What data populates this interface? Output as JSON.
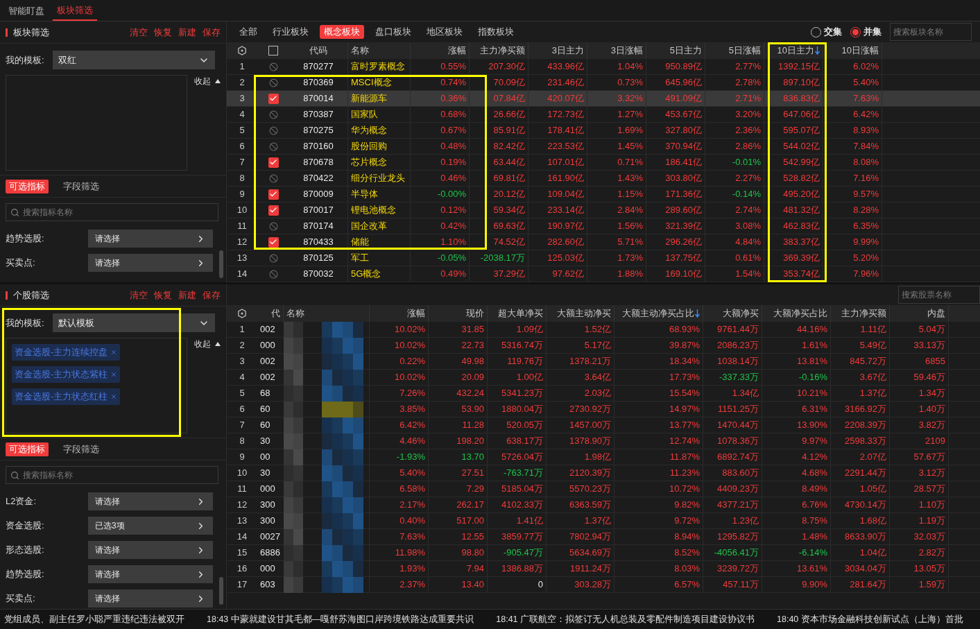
{
  "nav_tabs": [
    {
      "label": "智能盯盘",
      "selected": false
    },
    {
      "label": "板块筛选",
      "selected": true
    }
  ],
  "left_top": {
    "title": "板块筛选",
    "actions": [
      "清空",
      "恢复",
      "新建",
      "保存"
    ],
    "template_label": "我的模板:",
    "template_value": "双红",
    "collapse_label": "收起",
    "tabs": [
      {
        "label": "可选指标",
        "selected": true
      },
      {
        "label": "字段筛选",
        "selected": false
      }
    ],
    "search_placeholder": "搜索指标名称",
    "filters": [
      {
        "label": "趋势选股:",
        "value": "请选择"
      },
      {
        "label": "买卖点:",
        "value": "请选择"
      }
    ],
    "outlined": false
  },
  "left_bottom": {
    "title": "个股筛选",
    "actions": [
      "清空",
      "恢复",
      "新建",
      "保存"
    ],
    "template_label": "我的模板:",
    "template_value": "默认模板",
    "tags": [
      "资金选股-主力连续控盘",
      "资金选股-主力状态紫柱",
      "资金选股-主力状态红柱"
    ],
    "collapse_label": "收起",
    "tabs": [
      {
        "label": "可选指标",
        "selected": true
      },
      {
        "label": "字段筛选",
        "selected": false
      }
    ],
    "search_placeholder": "搜索指标名称",
    "filters": [
      {
        "label": "L2资金:",
        "value": "请选择"
      },
      {
        "label": "资金选股:",
        "value": "已选3项"
      },
      {
        "label": "形态选股:",
        "value": "请选择"
      },
      {
        "label": "趋势选股:",
        "value": "请选择"
      },
      {
        "label": "买卖点:",
        "value": "请选择"
      }
    ],
    "outlined": true
  },
  "sector_tabs": [
    {
      "label": "全部",
      "selected": false
    },
    {
      "label": "行业板块",
      "selected": false
    },
    {
      "label": "概念板块",
      "selected": true
    },
    {
      "label": "盘口板块",
      "selected": false
    },
    {
      "label": "地区板块",
      "selected": false
    },
    {
      "label": "指数板块",
      "selected": false
    }
  ],
  "set_modes": [
    {
      "label": "交集",
      "selected": false
    },
    {
      "label": "并集",
      "selected": true
    }
  ],
  "sector_search_placeholder": "搜索板块名称",
  "sector_table": {
    "select_all_checked": false,
    "columns": [
      {
        "label": "代码",
        "sorted": false,
        "outlined": false
      },
      {
        "label": "名称",
        "sorted": false,
        "outlined": false
      },
      {
        "label": "涨幅",
        "sorted": false,
        "outlined": false
      },
      {
        "label": "主力净买额",
        "sorted": false,
        "outlined": false
      },
      {
        "label": "3日主力",
        "sorted": false,
        "outlined": false
      },
      {
        "label": "3日涨幅",
        "sorted": false,
        "outlined": false
      },
      {
        "label": "5日主力",
        "sorted": false,
        "outlined": false
      },
      {
        "label": "5日涨幅",
        "sorted": false,
        "outlined": false
      },
      {
        "label": "10日主力",
        "sorted": true,
        "outlined": true
      },
      {
        "label": "10日涨幅",
        "sorted": false,
        "outlined": false
      }
    ],
    "rows": [
      {
        "index": "1",
        "checked": false,
        "selected": false,
        "boxed": false,
        "cells": [
          "870277",
          "富时罗素概念",
          "0.55%",
          "207.30亿",
          "433.96亿",
          "1.04%",
          "950.89亿",
          "2.77%",
          "1392.15亿",
          "6.02%"
        ]
      },
      {
        "index": "2",
        "checked": false,
        "selected": false,
        "boxed": true,
        "cells": [
          "870369",
          "MSCI概念",
          "0.74%",
          "70.09亿",
          "231.46亿",
          "0.73%",
          "645.96亿",
          "2.78%",
          "897.10亿",
          "5.40%"
        ]
      },
      {
        "index": "3",
        "checked": true,
        "selected": true,
        "boxed": true,
        "cells": [
          "870014",
          "新能源车",
          "0.36%",
          "07.84亿",
          "420.07亿",
          "3.32%",
          "491.09亿",
          "2.71%",
          "836.83亿",
          "7.63%"
        ]
      },
      {
        "index": "4",
        "checked": false,
        "selected": false,
        "boxed": true,
        "cells": [
          "870387",
          "国家队",
          "0.68%",
          "26.66亿",
          "172.73亿",
          "1.27%",
          "453.67亿",
          "3.20%",
          "647.06亿",
          "6.42%"
        ]
      },
      {
        "index": "5",
        "checked": false,
        "selected": false,
        "boxed": true,
        "cells": [
          "870275",
          "华为概念",
          "0.67%",
          "85.91亿",
          "178.41亿",
          "1.69%",
          "327.80亿",
          "2.36%",
          "595.07亿",
          "8.93%"
        ]
      },
      {
        "index": "6",
        "checked": false,
        "selected": false,
        "boxed": true,
        "cells": [
          "870160",
          "股份回购",
          "0.48%",
          "82.42亿",
          "223.53亿",
          "1.45%",
          "370.94亿",
          "2.86%",
          "544.02亿",
          "7.84%"
        ]
      },
      {
        "index": "7",
        "checked": true,
        "selected": false,
        "boxed": true,
        "cells": [
          "870678",
          "芯片概念",
          "0.19%",
          "63.44亿",
          "107.01亿",
          "0.71%",
          "186.41亿",
          "-0.01%",
          "542.99亿",
          "8.08%"
        ]
      },
      {
        "index": "8",
        "checked": false,
        "selected": false,
        "boxed": true,
        "cells": [
          "870422",
          "细分行业龙头",
          "0.46%",
          "69.81亿",
          "161.90亿",
          "1.43%",
          "303.80亿",
          "2.27%",
          "528.82亿",
          "7.16%"
        ]
      },
      {
        "index": "9",
        "checked": true,
        "selected": false,
        "boxed": true,
        "cells": [
          "870009",
          "半导体",
          "-0.00%",
          "20.12亿",
          "109.04亿",
          "1.15%",
          "171.36亿",
          "-0.14%",
          "495.20亿",
          "9.57%"
        ]
      },
      {
        "index": "10",
        "checked": true,
        "selected": false,
        "boxed": true,
        "cells": [
          "870017",
          "锂电池概念",
          "0.12%",
          "59.34亿",
          "233.14亿",
          "2.84%",
          "289.60亿",
          "2.74%",
          "481.32亿",
          "8.28%"
        ]
      },
      {
        "index": "11",
        "checked": false,
        "selected": false,
        "boxed": true,
        "cells": [
          "870174",
          "国企改革",
          "0.42%",
          "69.63亿",
          "190.97亿",
          "1.56%",
          "321.39亿",
          "3.08%",
          "462.83亿",
          "6.35%"
        ]
      },
      {
        "index": "12",
        "checked": true,
        "selected": false,
        "boxed": true,
        "cells": [
          "870433",
          "储能",
          "1.10%",
          "74.52亿",
          "282.60亿",
          "5.71%",
          "296.26亿",
          "4.84%",
          "383.37亿",
          "9.99%"
        ]
      },
      {
        "index": "13",
        "checked": false,
        "selected": false,
        "boxed": false,
        "cells": [
          "870125",
          "军工",
          "-0.05%",
          "-2038.17万",
          "125.03亿",
          "1.73%",
          "137.75亿",
          "0.61%",
          "369.39亿",
          "5.20%"
        ]
      },
      {
        "index": "14",
        "checked": false,
        "selected": false,
        "boxed": false,
        "cells": [
          "870032",
          "5G概念",
          "0.49%",
          "37.29亿",
          "97.62亿",
          "1.88%",
          "169.10亿",
          "1.54%",
          "353.74亿",
          "7.96%"
        ]
      }
    ]
  },
  "stock_search_placeholder": "搜索股票名称",
  "stock_table": {
    "columns": [
      {
        "label": "代",
        "sorted": false
      },
      {
        "label": "名称",
        "sorted": false
      },
      {
        "label": "涨幅",
        "sorted": false
      },
      {
        "label": "现价",
        "sorted": false
      },
      {
        "label": "超大单净买",
        "sorted": false
      },
      {
        "label": "大额主动净买",
        "sorted": false
      },
      {
        "label": "大额主动净买占比",
        "sorted": true
      },
      {
        "label": "大额净买",
        "sorted": false
      },
      {
        "label": "大额净买占比",
        "sorted": false
      },
      {
        "label": "主力净买额",
        "sorted": false
      },
      {
        "label": "内盘",
        "sorted": false
      }
    ],
    "rows": [
      {
        "index": "1",
        "cells": [
          "002",
          "",
          "10.02%",
          "31.85",
          "1.09亿",
          "1.52亿",
          "68.93%",
          "9761.44万",
          "44.16%",
          "1.11亿",
          "5.04万"
        ]
      },
      {
        "index": "2",
        "cells": [
          "000",
          "",
          "10.02%",
          "22.73",
          "5316.74万",
          "5.17亿",
          "39.87%",
          "2086.23万",
          "1.61%",
          "5.49亿",
          "33.13万"
        ]
      },
      {
        "index": "3",
        "cells": [
          "002",
          "",
          "0.22%",
          "49.98",
          "119.76万",
          "1378.21万",
          "18.34%",
          "1038.14万",
          "13.81%",
          "845.72万",
          "6855"
        ]
      },
      {
        "index": "4",
        "cells": [
          "002",
          "",
          "10.02%",
          "20.09",
          "1.00亿",
          "3.64亿",
          "17.73%",
          "-337.33万",
          "-0.16%",
          "3.67亿",
          "59.46万"
        ]
      },
      {
        "index": "5",
        "cells": [
          "68",
          "",
          "7.26%",
          "432.24",
          "5341.23万",
          "2.03亿",
          "15.54%",
          "1.34亿",
          "10.21%",
          "1.37亿",
          "1.34万"
        ]
      },
      {
        "index": "6",
        "cells": [
          "60",
          "",
          "3.85%",
          "53.90",
          "1880.04万",
          "2730.92万",
          "14.97%",
          "1151.25万",
          "6.31%",
          "3166.92万",
          "1.40万"
        ]
      },
      {
        "index": "7",
        "cells": [
          "60",
          "",
          "6.42%",
          "11.28",
          "520.05万",
          "1457.00万",
          "13.77%",
          "1470.44万",
          "13.90%",
          "2208.39万",
          "3.82万"
        ]
      },
      {
        "index": "8",
        "cells": [
          "30",
          "",
          "4.46%",
          "198.20",
          "638.17万",
          "1378.90万",
          "12.74%",
          "1078.36万",
          "9.97%",
          "2598.33万",
          "2109"
        ]
      },
      {
        "index": "9",
        "cells": [
          "00",
          "",
          "-1.93%",
          "13.70",
          "5726.04万",
          "1.98亿",
          "11.87%",
          "6892.74万",
          "4.12%",
          "2.07亿",
          "57.67万"
        ]
      },
      {
        "index": "10",
        "cells": [
          "30",
          "",
          "5.40%",
          "27.51",
          "-763.71万",
          "2120.39万",
          "11.23%",
          "883.60万",
          "4.68%",
          "2291.44万",
          "3.12万"
        ]
      },
      {
        "index": "11",
        "cells": [
          "000",
          "",
          "6.58%",
          "7.29",
          "5185.04万",
          "5570.23万",
          "10.72%",
          "4409.23万",
          "8.49%",
          "1.05亿",
          "28.57万"
        ]
      },
      {
        "index": "12",
        "cells": [
          "300",
          "",
          "2.17%",
          "262.17",
          "4102.33万",
          "6363.59万",
          "9.82%",
          "4377.21万",
          "6.76%",
          "4730.14万",
          "1.10万"
        ]
      },
      {
        "index": "13",
        "cells": [
          "300",
          "",
          "0.40%",
          "517.00",
          "1.41亿",
          "1.37亿",
          "9.72%",
          "1.23亿",
          "8.75%",
          "1.68亿",
          "1.19万"
        ]
      },
      {
        "index": "14",
        "cells": [
          "0027",
          "",
          "7.63%",
          "12.55",
          "3859.77万",
          "7802.94万",
          "8.94%",
          "1295.82万",
          "1.48%",
          "8633.90万",
          "32.03万"
        ]
      },
      {
        "index": "15",
        "cells": [
          "6886",
          "",
          "11.98%",
          "98.80",
          "-905.47万",
          "5634.69万",
          "8.52%",
          "-4056.41万",
          "-6.14%",
          "1.04亿",
          "2.82万"
        ]
      },
      {
        "index": "16",
        "cells": [
          "000",
          "",
          "1.93%",
          "7.94",
          "1386.88万",
          "1911.24万",
          "8.03%",
          "3239.72万",
          "13.61%",
          "3034.04万",
          "13.05万"
        ]
      },
      {
        "index": "17",
        "cells": [
          "603",
          "",
          "2.37%",
          "13.40",
          "0",
          "303.28万",
          "6.57%",
          "457.11万",
          "9.90%",
          "281.64万",
          "1.59万"
        ]
      }
    ]
  },
  "news_ticker": [
    {
      "text": "党组成员、副主任罗小聪严重违纪违法被双开"
    },
    {
      "time": "18:43",
      "text": "中蒙就建设甘其毛都—嘎舒苏海图口岸跨境铁路达成重要共识"
    },
    {
      "time": "18:41",
      "text": "广联航空：拟签订无人机总装及零配件制造项目建设协议书"
    },
    {
      "time": "18:40",
      "text": "资本市场金融科技创新试点（上海）首批"
    }
  ]
}
